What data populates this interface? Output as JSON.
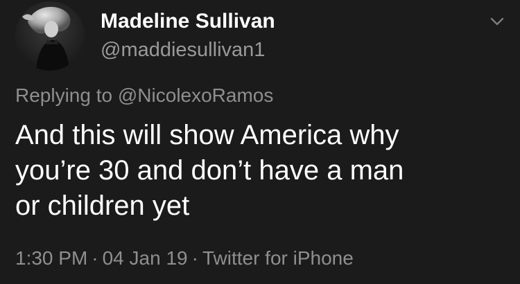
{
  "tweet": {
    "author": {
      "display_name": "Madeline Sullivan",
      "handle": "@maddiesullivan1",
      "avatar_icon": "profile-photo"
    },
    "reply_prefix": "Replying to",
    "reply_to": "@NicolexoRamos",
    "text": "And this will show America why\nyou’re 30 and don’t have a man\nor children yet",
    "meta": {
      "time": "1:30 PM",
      "separator": "·",
      "date": "04 Jan 19",
      "client": "Twitter for iPhone"
    },
    "menu_icon": "chevron-down-icon"
  },
  "colors": {
    "background": "#1b1b1b",
    "primary_text": "#ffffff",
    "secondary_text": "#8f8f8f"
  }
}
